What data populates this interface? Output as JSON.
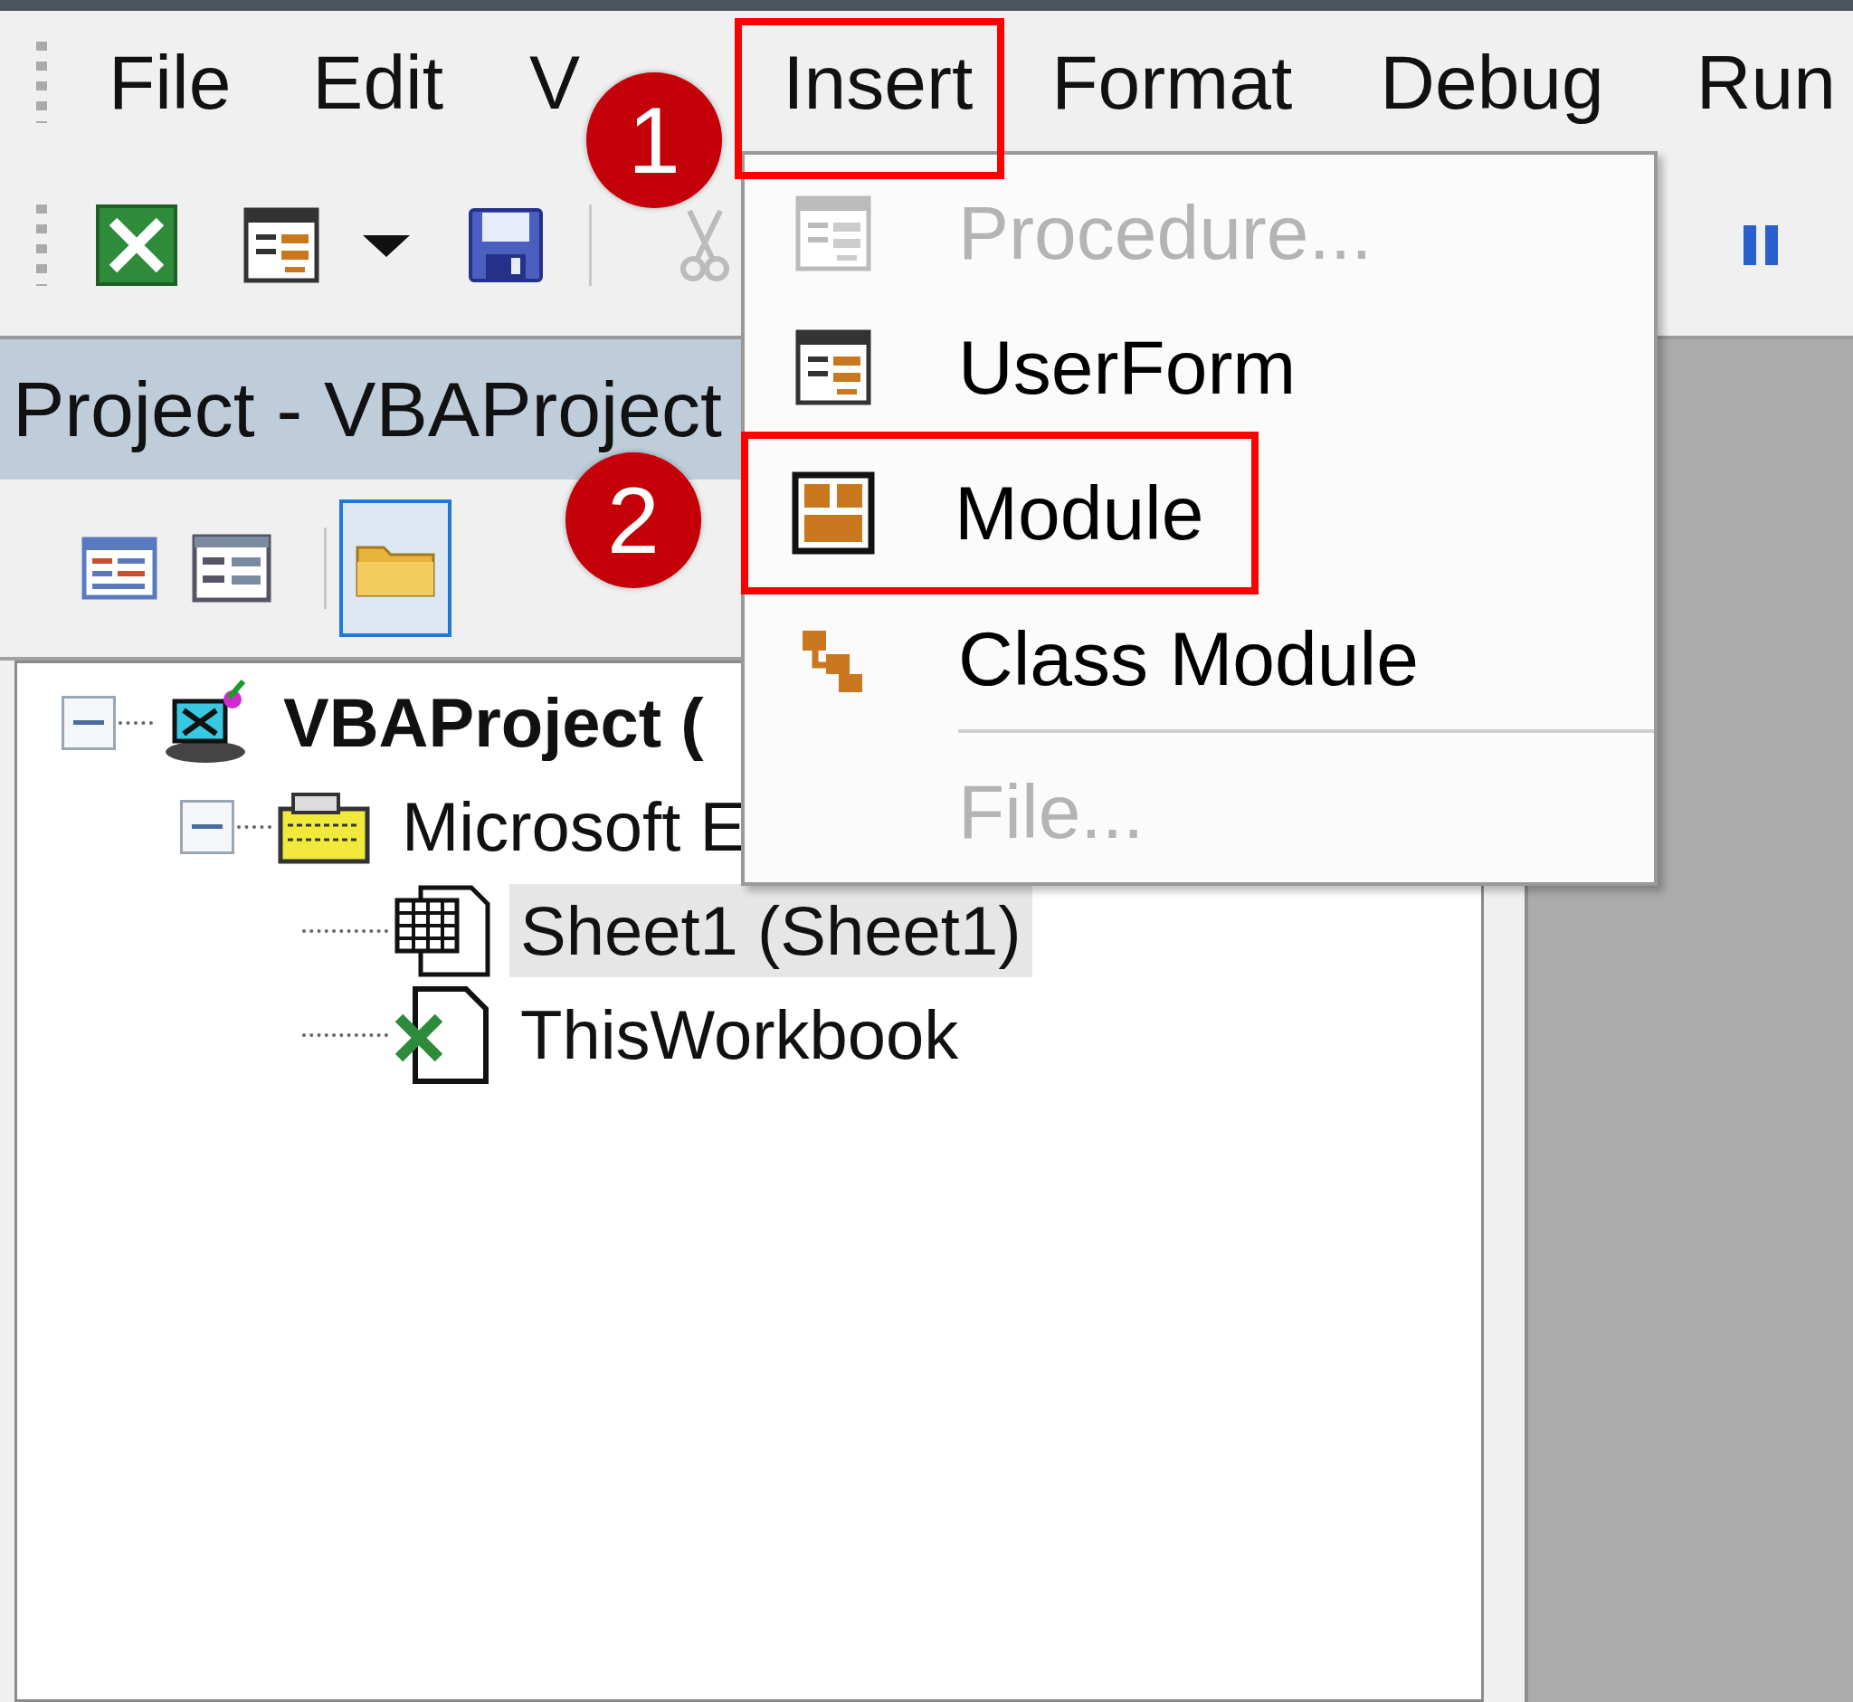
{
  "menubar": [
    {
      "label": "File",
      "highlighted": false
    },
    {
      "label": "Edit",
      "highlighted": false
    },
    {
      "label": "V",
      "highlighted": false
    },
    {
      "label": "Insert",
      "highlighted": true
    },
    {
      "label": "Format",
      "highlighted": false
    },
    {
      "label": "Debug",
      "highlighted": false
    },
    {
      "label": "Run",
      "highlighted": false
    }
  ],
  "project_panel": {
    "title": "Project - VBAProject",
    "view_buttons": [
      {
        "selected": false
      },
      {
        "selected": false
      },
      {
        "selected": true
      }
    ],
    "tree": [
      {
        "label": "VBAProject (",
        "expanded": true,
        "selected": false,
        "children": [
          {
            "label": "Microsoft E",
            "expanded": true,
            "selected": false,
            "children": [
              {
                "label": "Sheet1 (Sheet1)",
                "selected": true
              },
              {
                "label": "ThisWorkbook",
                "selected": false
              }
            ]
          }
        ]
      }
    ]
  },
  "insert_menu": {
    "items": [
      {
        "kind": "command",
        "label": "Procedure...",
        "disabled": true,
        "highlighted": false
      },
      {
        "kind": "command",
        "label": "UserForm",
        "disabled": false,
        "highlighted": false
      },
      {
        "kind": "command",
        "label": "Module",
        "disabled": false,
        "highlighted": true
      },
      {
        "kind": "command",
        "label": "Class Module",
        "disabled": false,
        "highlighted": false
      },
      {
        "kind": "separator"
      },
      {
        "kind": "command",
        "label": "File...",
        "disabled": true,
        "highlighted": false
      }
    ]
  },
  "callouts": [
    {
      "label": "1"
    },
    {
      "label": "2"
    }
  ]
}
